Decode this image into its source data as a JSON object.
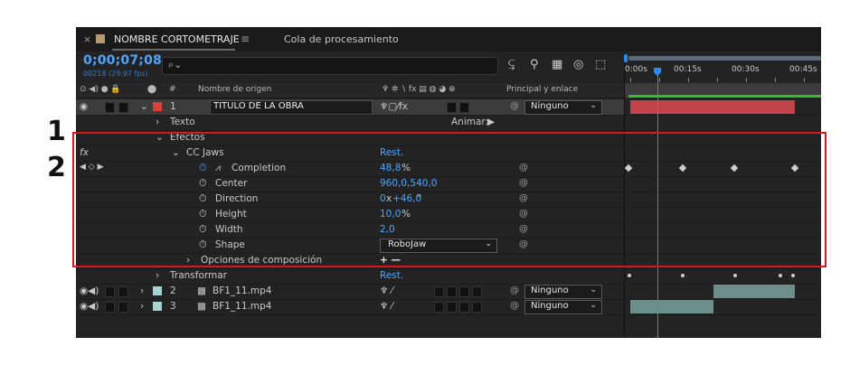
{
  "tabs": {
    "close": "×",
    "comp_title": "NOMBRE CORTOMETRAJE",
    "menu": "≡",
    "render_queue": "Cola de procesamiento"
  },
  "timecode": {
    "time": "0;00;07;08",
    "frames": "00218 (29.97 fps)"
  },
  "search": {
    "icon": "⌕⌄",
    "value": ""
  },
  "toolbar_icons": [
    "comp-mini-flowchart-icon",
    "shy-layers-icon",
    "frame-blending-icon",
    "motion-blur-icon",
    "graph-editor-icon"
  ],
  "ruler": {
    "labels": [
      "0:00s",
      "00:15s",
      "00:30s",
      "00:45s"
    ]
  },
  "columns": {
    "switches": "⊙ ◀) ● 🔒",
    "label_col": "#",
    "source_name": "Nombre de origen",
    "parent": "Principal y enlace"
  },
  "layers": [
    {
      "num": "1",
      "name": "TITULO DE LA OBRA",
      "label_color": "#d8423a",
      "parent": "Ninguno"
    },
    {
      "num": "2",
      "name": "BF1_11.mp4",
      "label_color": "#a7d4d0",
      "parent": "Ninguno"
    },
    {
      "num": "3",
      "name": "BF1_11.mp4",
      "label_color": "#a7d4d0",
      "parent": "Ninguno"
    }
  ],
  "groups": {
    "texto": "Texto",
    "animar": "Animar:",
    "efectos": "Efectos",
    "fx": "fx",
    "cc_jaws": "CC Jaws",
    "reset": "Rest.",
    "opciones": "Opciones de composición",
    "opciones_ctrl": "+ —",
    "transformar": "Transformar",
    "transform_reset": "Rest."
  },
  "properties": [
    {
      "name": "Completion",
      "value": "48,8",
      "unit": "%"
    },
    {
      "name": "Center",
      "value": "960,0,540,0",
      "unit": ""
    },
    {
      "name": "Direction",
      "value": "0",
      "unit_mid": "x",
      "value2": "+46,0",
      "unit": "°"
    },
    {
      "name": "Height",
      "value": "10,0",
      "unit": "%"
    },
    {
      "name": "Width",
      "value": "2,0",
      "unit": ""
    },
    {
      "name": "Shape",
      "value": "RoboJaw",
      "unit": ""
    }
  ],
  "keyframe_nav": "◀ ◇ ▶",
  "annotations": {
    "one": "1",
    "two": "2"
  },
  "colors": {
    "accent": "#4da6ff",
    "annotation": "#e0141e",
    "work_area_green": "#2fbf2f",
    "layer1_bar": "#c2444a",
    "layer2_bar": "#6d8f8c"
  }
}
